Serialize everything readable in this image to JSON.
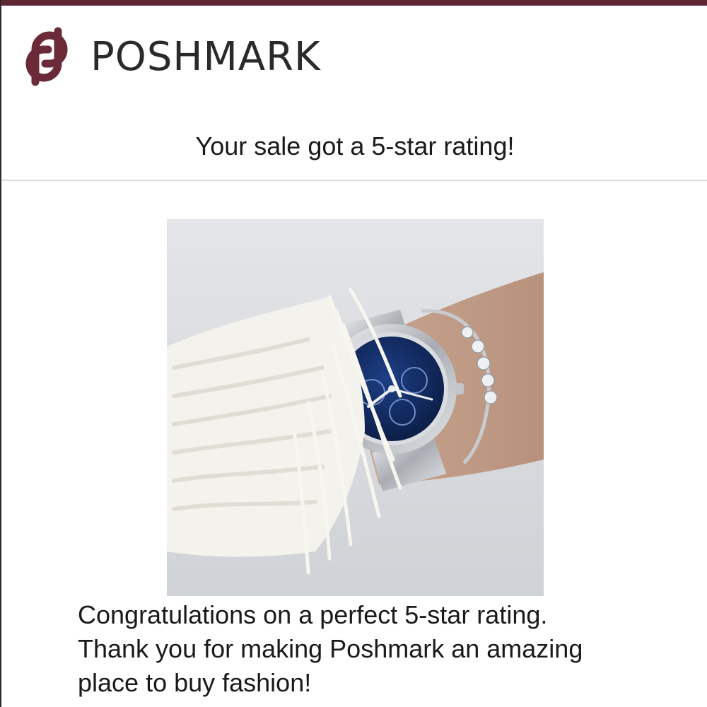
{
  "brand": {
    "name": "POSHMARK",
    "logo_icon": "poshmark-logo-icon",
    "color": "#6b2a38"
  },
  "email": {
    "headline": "Your sale got a 5-star rating!",
    "image": {
      "subject": "product-photo",
      "icons": [
        "watch-icon",
        "bracelet-icon",
        "sweater-icon"
      ]
    },
    "message_lines": [
      "Congratulations on a perfect 5-star rating.",
      "Thank you for making Poshmark an amazing",
      "place to buy fashion!"
    ]
  },
  "colors": {
    "top_bar": "#5e2733",
    "divider": "#dcdcdc",
    "text": "#1a1a1a"
  }
}
